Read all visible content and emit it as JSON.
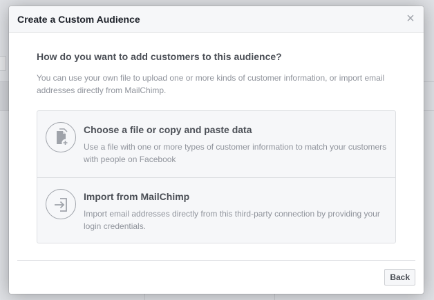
{
  "dialog": {
    "title": "Create a Custom Audience",
    "close_symbol": "×",
    "question": "How do you want to add customers to this audience?",
    "description": "You can use your own file to upload one or more kinds of customer information, or import email addresses directly from MailChimp.",
    "options": [
      {
        "title": "Choose a file or copy and paste data",
        "description": "Use a file with one or more types of customer information to match your customers with people on Facebook",
        "icon": "file-add-icon"
      },
      {
        "title": "Import from MailChimp",
        "description": "Import email addresses directly from this third-party connection by providing your login credentials.",
        "icon": "import-arrow-icon"
      }
    ],
    "back_label": "Back"
  },
  "colors": {
    "header_bg": "#f6f7f9",
    "title_text": "#1d2129",
    "body_text": "#4b4f56",
    "muted_text": "#90949c",
    "border": "#dddfe2"
  }
}
